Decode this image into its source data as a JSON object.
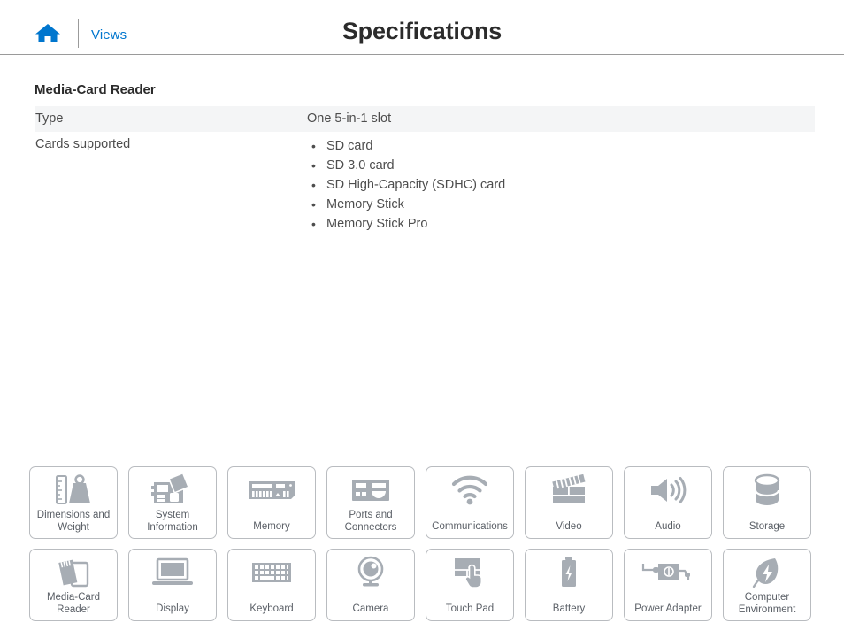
{
  "header": {
    "home_icon": "home-icon",
    "views_label": "Views",
    "title": "Specifications"
  },
  "section": {
    "title": "Media-Card Reader",
    "rows": [
      {
        "label": "Type",
        "value": "One 5-in-1 slot",
        "items": [],
        "shaded": true
      },
      {
        "label": "Cards supported",
        "value": "",
        "items": [
          "SD card",
          "SD 3.0 card",
          "SD High-Capacity (SDHC) card",
          "Memory Stick",
          "Memory Stick Pro"
        ],
        "shaded": false
      }
    ]
  },
  "tiles": {
    "row1": [
      {
        "label": "Dimensions and Weight",
        "icon": "ruler-weight-icon"
      },
      {
        "label": "System Information",
        "icon": "motherboard-icon"
      },
      {
        "label": "Memory",
        "icon": "memory-module-icon"
      },
      {
        "label": "Ports and Connectors",
        "icon": "ports-icon"
      },
      {
        "label": "Communications",
        "icon": "wifi-icon"
      },
      {
        "label": "Video",
        "icon": "clapperboard-icon"
      },
      {
        "label": "Audio",
        "icon": "speaker-icon"
      },
      {
        "label": "Storage",
        "icon": "disk-cylinder-icon"
      }
    ],
    "row2": [
      {
        "label": "Media-Card Reader",
        "icon": "media-card-icon"
      },
      {
        "label": "Display",
        "icon": "laptop-display-icon"
      },
      {
        "label": "Keyboard",
        "icon": "keyboard-icon"
      },
      {
        "label": "Camera",
        "icon": "webcam-icon"
      },
      {
        "label": "Touch Pad",
        "icon": "touchpad-hand-icon"
      },
      {
        "label": "Battery",
        "icon": "battery-icon"
      },
      {
        "label": "Power Adapter",
        "icon": "power-adapter-icon"
      },
      {
        "label": "Computer Environment",
        "icon": "leaf-bolt-icon"
      }
    ]
  },
  "colors": {
    "accent_blue": "#0076ce",
    "title_dark": "#2b2b2b",
    "row_shade": "#f4f5f6",
    "icon_gray": "#a7adb4",
    "tile_border": "#b9bcc0"
  }
}
